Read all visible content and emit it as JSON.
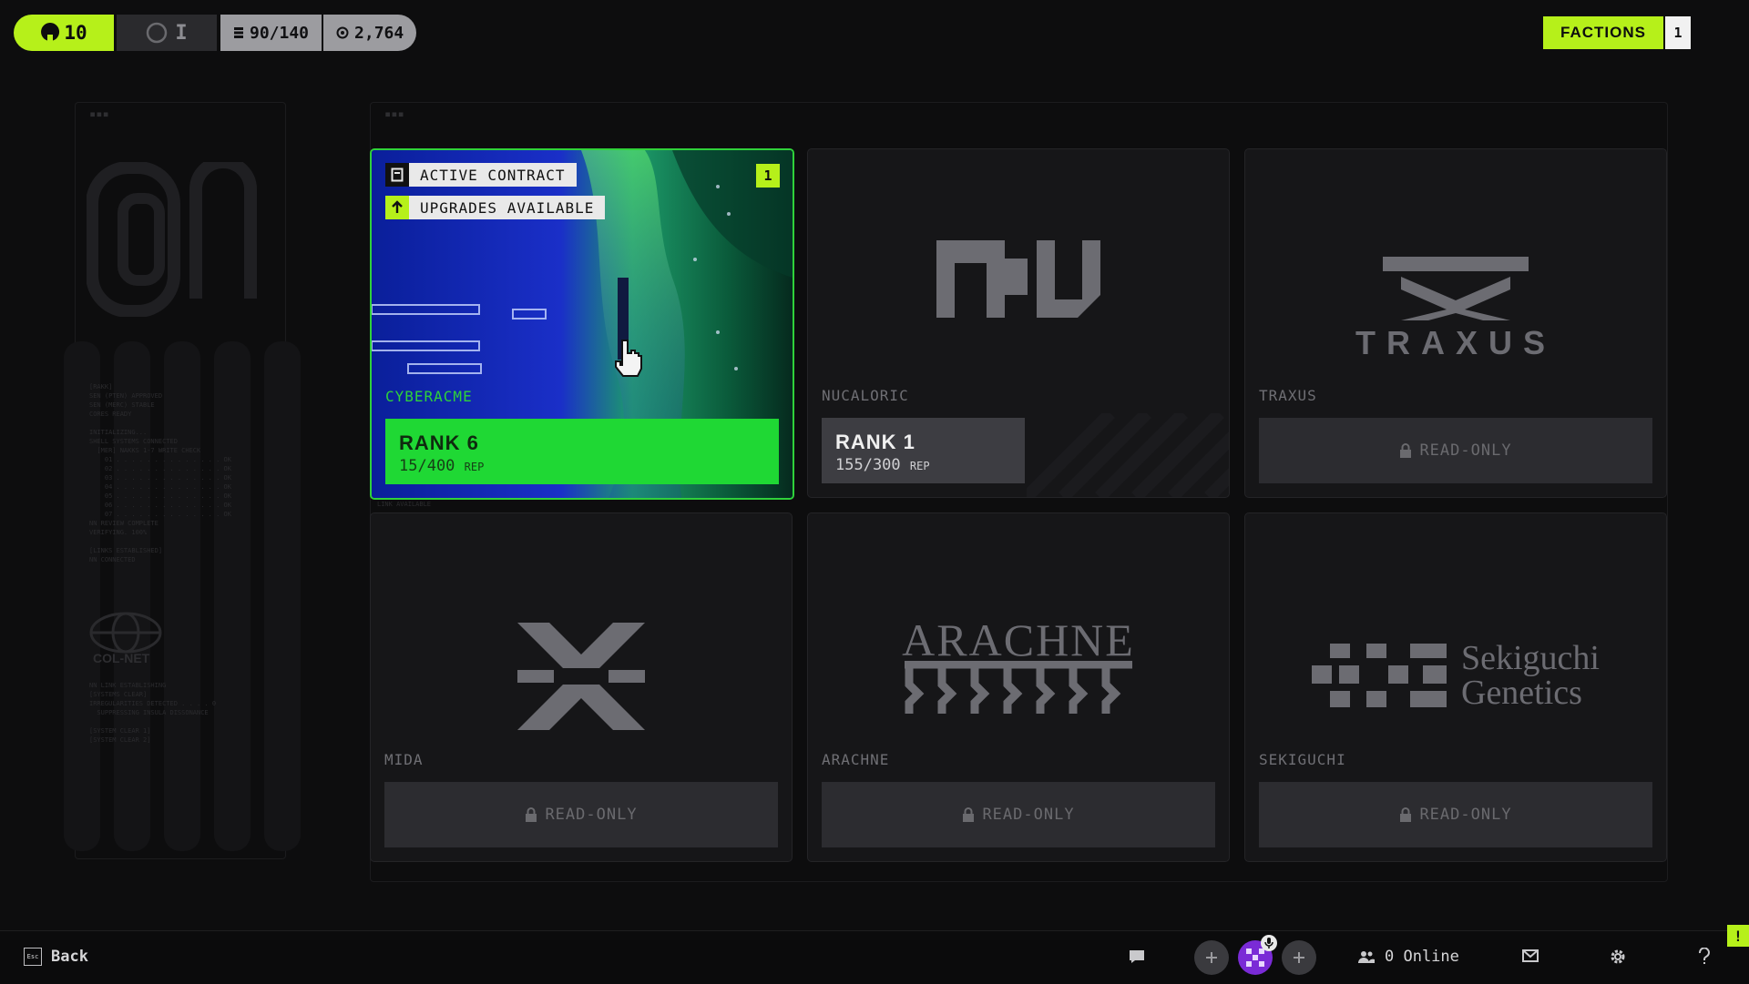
{
  "topbar": {
    "level": "10",
    "prestige": "I",
    "capacity": "90/140",
    "credits": "2,764",
    "factions_label": "FACTIONS",
    "factions_count": "1"
  },
  "cards": [
    {
      "id": "cyberacme",
      "name": "CYBERACME",
      "rank": "RANK 6",
      "rep": "15/400",
      "rep_unit": "REP",
      "tags": [
        "ACTIVE CONTRACT",
        "UPGRADES AVAILABLE"
      ],
      "notification": "1",
      "status": "active"
    },
    {
      "id": "nucaloric",
      "name": "NUCALORIC",
      "rank": "RANK 1",
      "rep": "155/300",
      "rep_unit": "REP",
      "status": "ranked"
    },
    {
      "id": "traxus",
      "name": "TRAXUS",
      "logo_text": "TRAXUS",
      "action": "READ-ONLY",
      "status": "read-only"
    },
    {
      "id": "mida",
      "name": "MIDA",
      "action": "READ-ONLY",
      "status": "read-only"
    },
    {
      "id": "arachne",
      "name": "ARACHNE",
      "logo_text": "ARACHNE",
      "action": "READ-ONLY",
      "status": "read-only"
    },
    {
      "id": "sekiguchi",
      "name": "SEKIGUCHI",
      "logo_text": [
        "Sekiguchi",
        "Genetics"
      ],
      "action": "READ-ONLY",
      "status": "read-only"
    }
  ],
  "background": {
    "colnet_label": "COL-NET",
    "link_available": "LINK AVAILABLE"
  },
  "bottombar": {
    "back_label": "Back",
    "back_key": "Esc",
    "online": "0 Online",
    "alert": "!"
  },
  "colors": {
    "accent": "#b6f01a",
    "active_green": "#1fd834",
    "card_bg": "#161618",
    "page_bg": "#0d0d0e"
  }
}
